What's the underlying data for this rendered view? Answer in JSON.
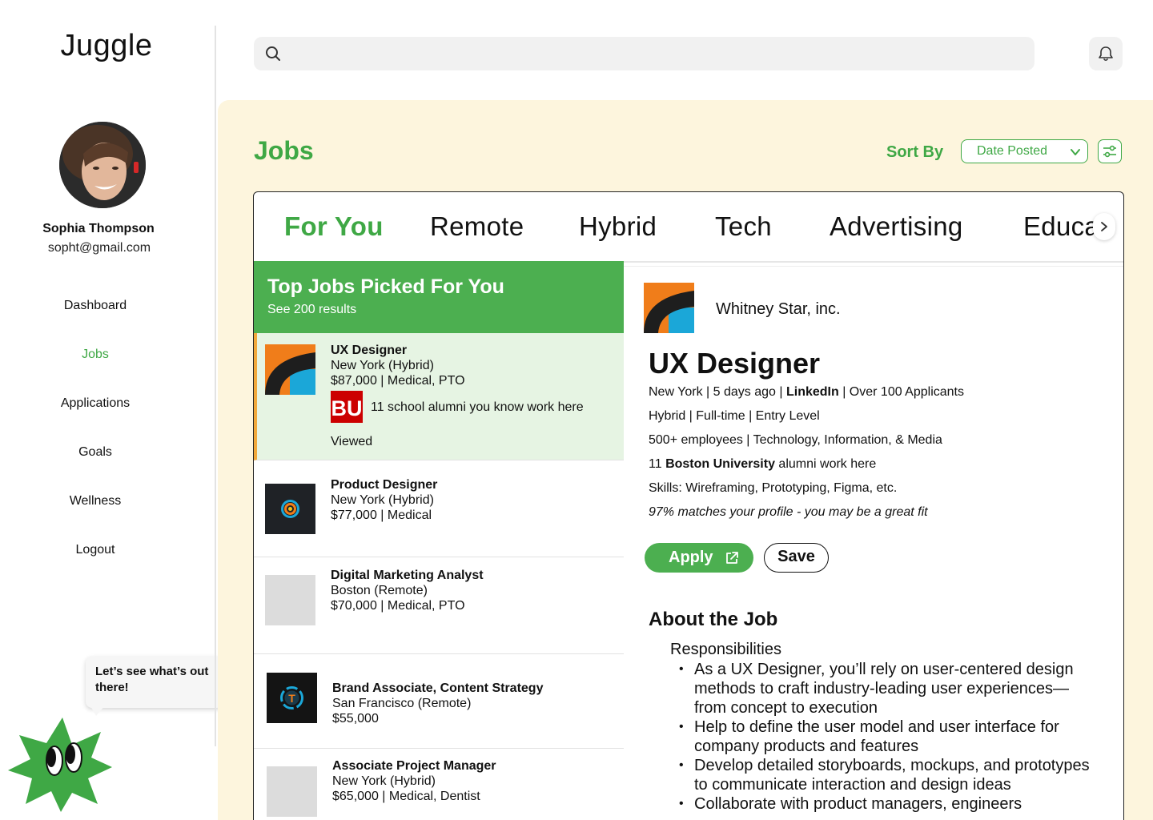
{
  "app": {
    "title": "Juggle"
  },
  "user": {
    "name": "Sophia Thompson",
    "email": "sopht@gmail.com"
  },
  "nav": {
    "items": [
      {
        "label": "Dashboard",
        "active": false
      },
      {
        "label": "Jobs",
        "active": true
      },
      {
        "label": "Applications",
        "active": false
      },
      {
        "label": "Goals",
        "active": false
      },
      {
        "label": "Wellness",
        "active": false
      },
      {
        "label": "Logout",
        "active": false
      }
    ]
  },
  "mascot": {
    "message": "Let’s see what’s out there!"
  },
  "search": {
    "placeholder": ""
  },
  "page": {
    "title": "Jobs",
    "sort_label": "Sort By",
    "sort_value": "Date Posted"
  },
  "tabs": [
    "For You",
    "Remote",
    "Hybrid",
    "Tech",
    "Advertising",
    "Educati"
  ],
  "list": {
    "title": "Top Jobs Picked For You",
    "subtitle": "See 200 results",
    "jobs": [
      {
        "title": "UX Designer",
        "location": "New York (Hybrid)",
        "pay": "$87,000 | Medical, PTO",
        "alumni": "11 school alumni you know work here",
        "alumni_logo": "BU",
        "status": "Viewed"
      },
      {
        "title": "Product Designer",
        "location": "New York (Hybrid)",
        "pay": "$77,000 | Medical"
      },
      {
        "title": "Digital Marketing Analyst",
        "location": "Boston (Remote)",
        "pay": "$70,000 | Medical, PTO"
      },
      {
        "title": "Brand Associate, Content Strategy",
        "location": "San Francisco (Remote)",
        "pay": "$55,000",
        "logo_letter": "T"
      },
      {
        "title": "Associate Project Manager",
        "location": "New York (Hybrid)",
        "pay": "$65,000 | Medical, Dentist"
      }
    ]
  },
  "detail": {
    "company": "Whitney Star, inc.",
    "title": "UX Designer",
    "meta": {
      "location": "New York | 5 days ago | ",
      "source": "LinkedIn",
      "applicants": " | Over 100 Applicants",
      "type": "Hybrid | Full-time | Entry Level",
      "company_info": "500+ employees | Technology, Information, & Media",
      "alumni_count": "11 ",
      "alumni_school": "Boston University",
      "alumni_suffix": " alumni work here",
      "skills": "Skills: Wireframing, Prototyping, Figma, etc.",
      "match": "97% matches your profile - you may be a great fit"
    },
    "apply_label": "Apply",
    "save_label": "Save",
    "about_title": "About the Job",
    "responsibilities_title": "Responsibilities",
    "responsibilities": [
      "As a UX Designer, you’ll rely on user-centered design methods to craft industry-leading user experiences—from concept to execution",
      "Help to define the user model and user interface for company products and features",
      "Develop detailed storyboards, mockups, and prototypes to communicate interaction and design ideas",
      "Collaborate with product managers, engineers"
    ]
  },
  "colors": {
    "brand_green": "#3fa845",
    "header_green": "#4caf50",
    "main_bg": "#fdf5dd",
    "selected_bg": "#e6f4e3",
    "selected_accent": "#f2a93b"
  }
}
